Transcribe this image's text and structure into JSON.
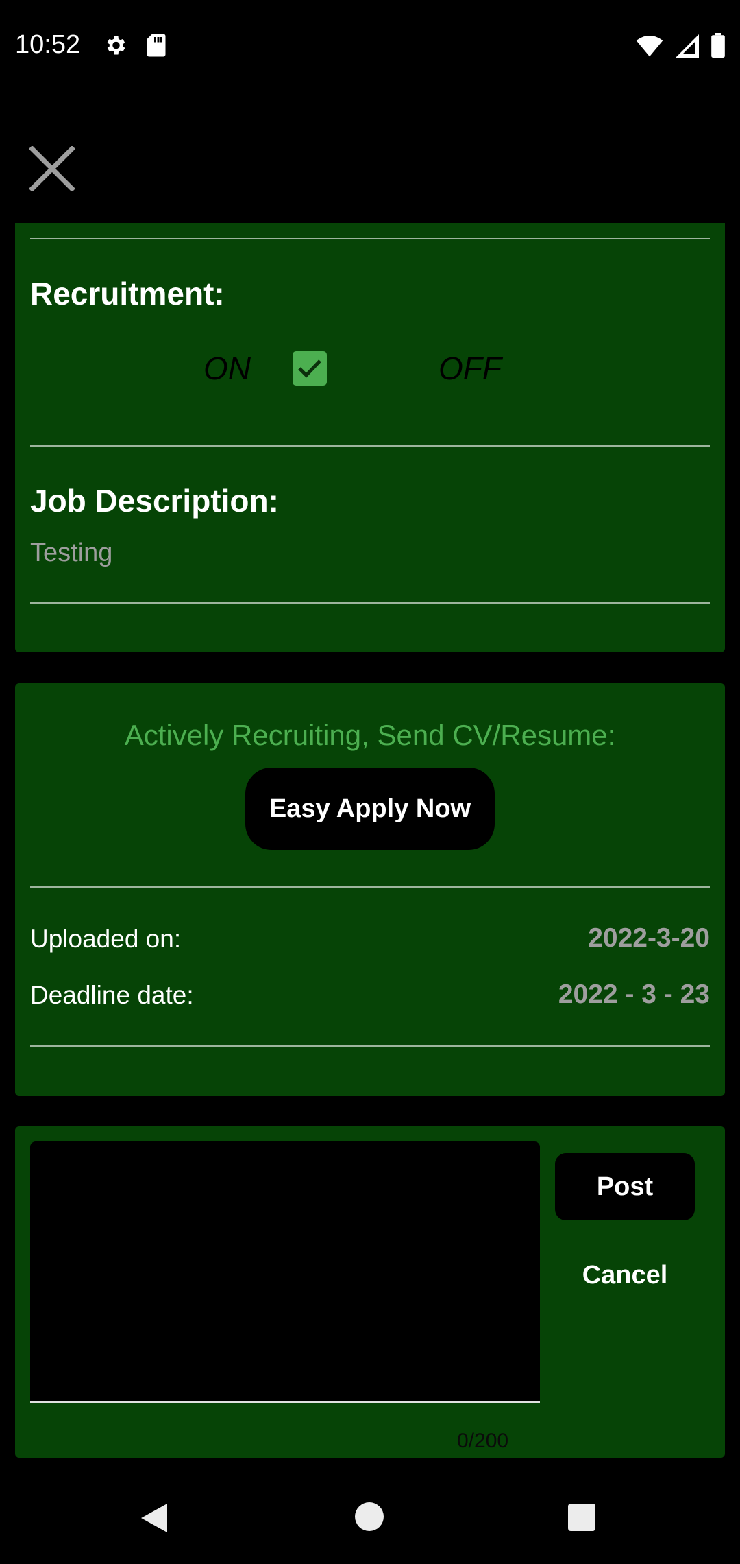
{
  "status_bar": {
    "time": "10:52",
    "left_icons": [
      "gear-icon",
      "sd-card-icon"
    ],
    "right_icons": [
      "wifi-icon",
      "signal-icon",
      "battery-icon"
    ]
  },
  "toolbar": {
    "close_icon": "close-icon"
  },
  "recruitment": {
    "heading": "Recruitment:",
    "on_label": "ON",
    "off_label": "OFF",
    "checked": true
  },
  "job_description": {
    "heading": "Job Description:",
    "text": "Testing"
  },
  "apply": {
    "message": "Actively Recruiting, Send CV/Resume:",
    "button_label": "Easy Apply Now"
  },
  "dates": {
    "uploaded_label": "Uploaded on:",
    "uploaded_value": "2022-3-20",
    "deadline_label": "Deadline date:",
    "deadline_value": "2022 - 3 - 23"
  },
  "comment": {
    "value": "",
    "counter": "0/200",
    "post_label": "Post",
    "cancel_label": "Cancel"
  },
  "nav": {
    "icons": [
      "back-icon",
      "home-icon",
      "recents-icon"
    ]
  },
  "colors": {
    "card_bg": "#064406",
    "accent_green": "#4caf50",
    "muted_text": "#9e9e9e"
  }
}
